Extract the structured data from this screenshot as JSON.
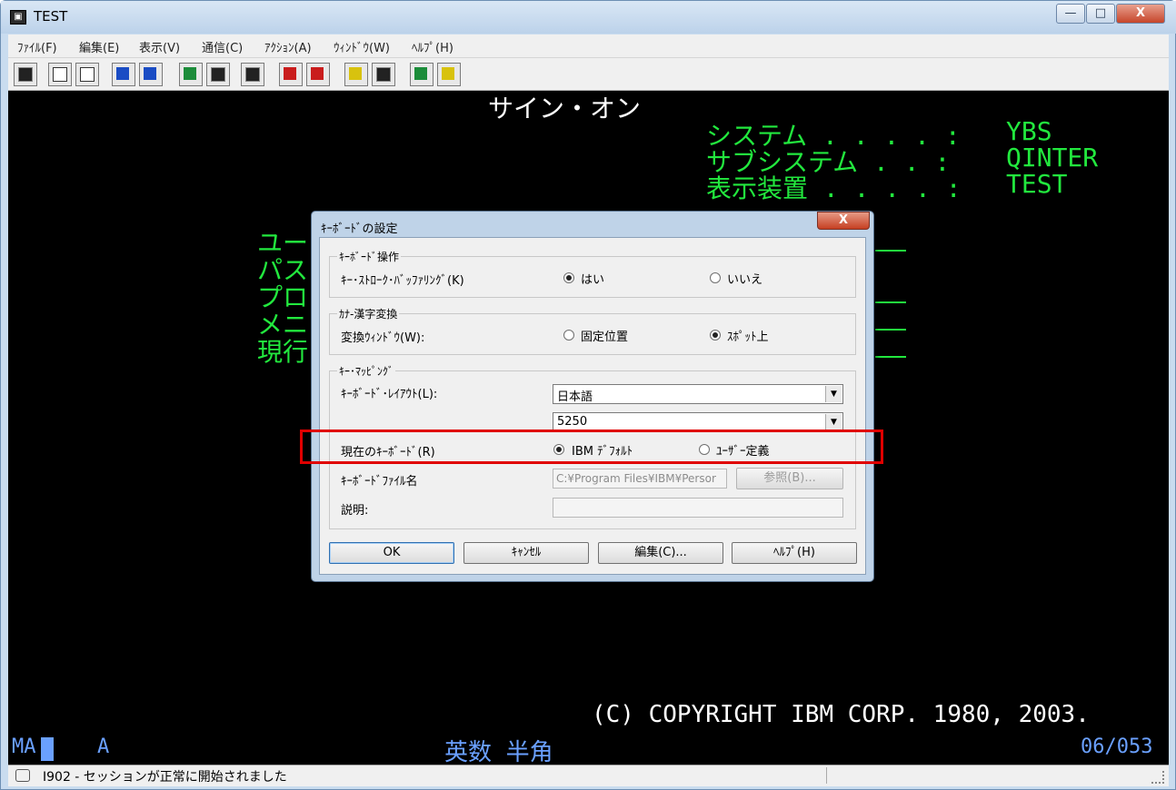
{
  "window": {
    "title": "TEST",
    "close_glyph": "X",
    "min_glyph": "—",
    "max_glyph": "□"
  },
  "menu": [
    "ﾌｧｲﾙ(F)",
    "編集(E)",
    "表示(V)",
    "通信(C)",
    "ｱｸｼｮﾝ(A)",
    "ｳｨﾝﾄﾞｳ(W)",
    "ﾍﾙﾌﾟ(H)"
  ],
  "terminal": {
    "heading": "サイン・オン",
    "system_label": "システム . . . . :",
    "system_value": "YBS",
    "subsystem_label": "サブシステム . . :",
    "subsystem_value": "QINTER",
    "display_label": "表示装置 . . . . :",
    "display_value": "TEST",
    "left_fragments": [
      "ユー",
      "パス",
      "プロ",
      "メニ",
      "現行"
    ],
    "copyright": "(C) COPYRIGHT IBM CORP. 1980, 2003."
  },
  "oia": {
    "left": "MA",
    "a": "A",
    "mode": "英数 半角",
    "position": "06/053"
  },
  "status": {
    "message": "I902 - セッションが正常に開始されました"
  },
  "dialog": {
    "title": "ｷｰﾎﾞｰﾄﾞの設定",
    "close": "X",
    "group1": {
      "title": "ｷｰﾎﾞｰﾄﾞ操作",
      "label": "ｷｰ･ｽﾄﾛｰｸ･ﾊﾞｯﾌｧﾘﾝｸﾞ(K)",
      "opt_yes": "はい",
      "opt_no": "いいえ",
      "selected": "yes"
    },
    "group2": {
      "title": "ｶﾅ-漢字変換",
      "label": "変換ｳｨﾝﾄﾞｳ(W):",
      "opt_fixed": "固定位置",
      "opt_spot": "ｽﾎﾟｯﾄ上",
      "selected": "spot"
    },
    "group3": {
      "title": "ｷｰ･ﾏｯﾋﾟﾝｸﾞ",
      "layout_label": "ｷｰﾎﾞｰﾄﾞ･ﾚｲｱｳﾄ(L):",
      "layout_value": "日本語",
      "type_value": "5250",
      "current_label": "現在のｷｰﾎﾞｰﾄﾞ(R)",
      "opt_ibm": "IBM ﾃﾞﾌｫﾙﾄ",
      "opt_user": "ﾕｰｻﾞｰ定義",
      "selected": "ibm",
      "file_label": "ｷｰﾎﾞｰﾄﾞﾌｧｲﾙ名",
      "file_value": "C:¥Program Files¥IBM¥Persor",
      "browse_label": "参照(B)...",
      "desc_label": "説明:"
    },
    "buttons": {
      "ok": "OK",
      "cancel": "ｷｬﾝｾﾙ",
      "edit": "編集(C)...",
      "help": "ﾍﾙﾌﾟ(H)"
    }
  }
}
